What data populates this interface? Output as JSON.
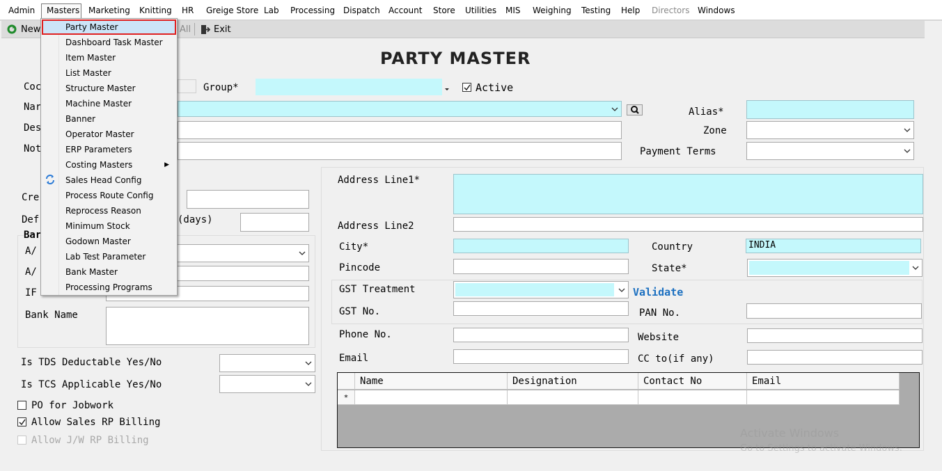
{
  "menubar": {
    "items": [
      "Admin",
      "Masters",
      "Marketing",
      "Knitting",
      "HR",
      "Greige Store",
      "Lab",
      "Processing",
      "Dispatch",
      "Account",
      "Store",
      "Utilities",
      "MIS",
      "Weighing",
      "Testing",
      "Help",
      "Directors",
      "Windows"
    ]
  },
  "toolbar": {
    "new_label": "New",
    "all_label": "All",
    "exit_label": "Exit"
  },
  "dropdown": {
    "items": [
      "Party Master",
      "Dashboard Task Master",
      "Item Master",
      "List Master",
      "Structure Master",
      "Machine Master",
      "Banner",
      "Operator Master",
      "ERP Parameters",
      "Costing Masters",
      "Sales Head Config",
      "Process Route Config",
      "Reprocess Reason",
      "Minimum Stock",
      "Godown Master",
      "Lab Test Parameter",
      "Bank Master",
      "Processing Programs"
    ],
    "selected": "Party Master"
  },
  "form": {
    "title": "PARTY MASTER",
    "code_label": "Coc",
    "name_label": "Nar",
    "desc_label": "Des",
    "notes_label": "Not",
    "group_label": "Group*",
    "active_label": "Active",
    "alias_label": "Alias*",
    "zone_label": "Zone",
    "payment_terms_label": "Payment Terms",
    "credit_label": "Cre",
    "default_label": "Def",
    "days_label": "(days)",
    "bank_section_label": "Bar",
    "ac1_label": "A/",
    "ac2_label": "A/",
    "ifsc_label": "IF",
    "bank_name_label": "Bank Name",
    "tds_label": "Is TDS Deductable Yes/No",
    "tcs_label": "Is TCS Applicable Yes/No",
    "po_jobwork_label": "PO for Jobwork",
    "allow_sales_rp_label": "Allow Sales RP Billing",
    "allow_jw_rp_label": "Allow J/W RP Billing",
    "address1_label": "Address Line1*",
    "address2_label": "Address Line2",
    "city_label": "City*",
    "country_label": "Country",
    "country_value": "INDIA",
    "pincode_label": "Pincode",
    "state_label": "State*",
    "gst_treatment_label": "GST Treatment",
    "validate_label": "Validate",
    "gst_no_label": "GST No.",
    "pan_no_label": "PAN No.",
    "phone_label": "Phone No.",
    "website_label": "Website",
    "email_label": "Email",
    "cc_label": "CC to(if any)"
  },
  "contacts_grid": {
    "columns": [
      "Name",
      "Designation",
      "Contact No",
      "Email"
    ],
    "new_row_marker": "*"
  },
  "watermark": {
    "line1": "Activate Windows",
    "line2": "Go to Settings to activate Windows."
  },
  "colors": {
    "required_field": "#c4f8fc",
    "validate_link": "#1a6fc0",
    "selection_outline": "#e02020"
  }
}
